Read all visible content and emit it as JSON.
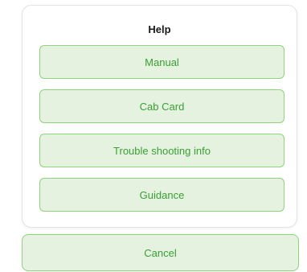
{
  "sheet": {
    "title": "Help",
    "actions": [
      {
        "label": "Manual"
      },
      {
        "label": "Cab Card"
      },
      {
        "label": "Trouble shooting info"
      },
      {
        "label": "Guidance"
      }
    ]
  },
  "cancel": {
    "label": "Cancel"
  },
  "colors": {
    "button_fill": "#e4f2df",
    "button_border": "#8fd37c",
    "button_text": "#3aa035",
    "title_text": "#1a1a1a"
  }
}
